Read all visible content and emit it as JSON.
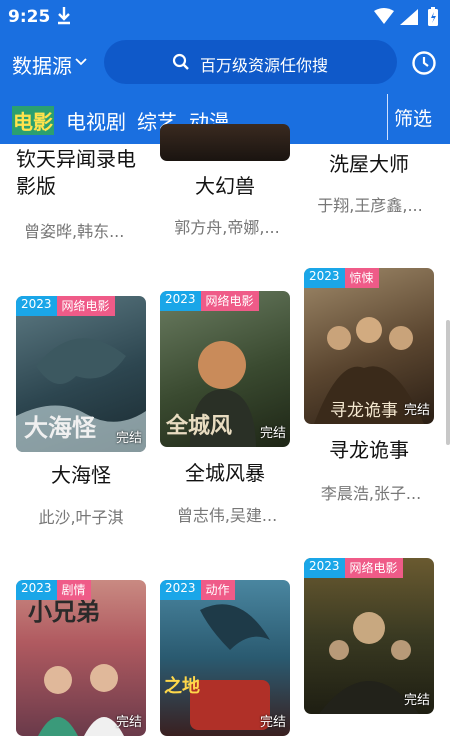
{
  "status": {
    "time": "9:25"
  },
  "header": {
    "source_label": "数据源",
    "search_placeholder": "百万级资源任你搜"
  },
  "tabs": [
    {
      "label": "电影"
    },
    {
      "label": "电视剧"
    },
    {
      "label": "综艺"
    },
    {
      "label": "动漫"
    }
  ],
  "filter_label": "筛选",
  "movies": [
    {
      "title": "钦天异闻录电影版",
      "actors": "曾姿晔,韩东..."
    },
    {
      "title": "大幻兽",
      "actors": "郭方舟,帝娜,..."
    },
    {
      "title": "洗屋大师",
      "actors": "于翔,王彦鑫,..."
    },
    {
      "year": "2023",
      "category": "网络电影",
      "status": "完结",
      "title": "大海怪",
      "actors": "此沙,叶子淇"
    },
    {
      "year": "2023",
      "category": "网络电影",
      "status": "完结",
      "title": "全城风暴",
      "actors": "曾志伟,吴建..."
    },
    {
      "year": "2023",
      "category": "惊悚",
      "status": "完结",
      "title": "寻龙诡事",
      "actors": "李晨浩,张子..."
    },
    {
      "year": "2023",
      "category": "剧情",
      "status": "完结"
    },
    {
      "year": "2023",
      "category": "动作",
      "status": "完结"
    },
    {
      "year": "2023",
      "category": "网络电影",
      "status": "完结"
    }
  ],
  "colors": {
    "appbar": "#1a6fe0",
    "active_tab": "#ffe34d",
    "year_badge": "#1aa6e8",
    "category_badge": "#ef5b88"
  }
}
